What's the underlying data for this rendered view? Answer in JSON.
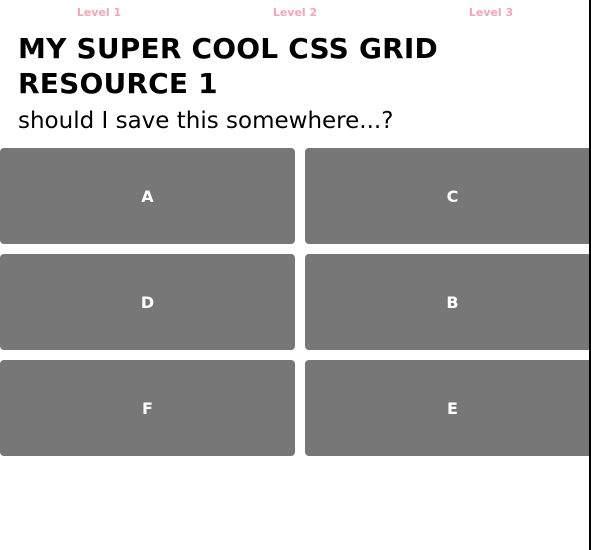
{
  "colors": {
    "level_link": "#f4a6b5",
    "tile_background": "#777777",
    "tile_text": "#ffffff"
  },
  "nav": {
    "levels": [
      {
        "label": "Level 1"
      },
      {
        "label": "Level 2"
      },
      {
        "label": "Level 3"
      }
    ]
  },
  "header": {
    "title": "MY SUPER COOL CSS GRID RESOURCE 1",
    "subtitle": "should I save this somewhere...?"
  },
  "grid": {
    "items": [
      {
        "label": "A"
      },
      {
        "label": "C"
      },
      {
        "label": "D"
      },
      {
        "label": "B"
      },
      {
        "label": "F"
      },
      {
        "label": "E"
      }
    ]
  }
}
